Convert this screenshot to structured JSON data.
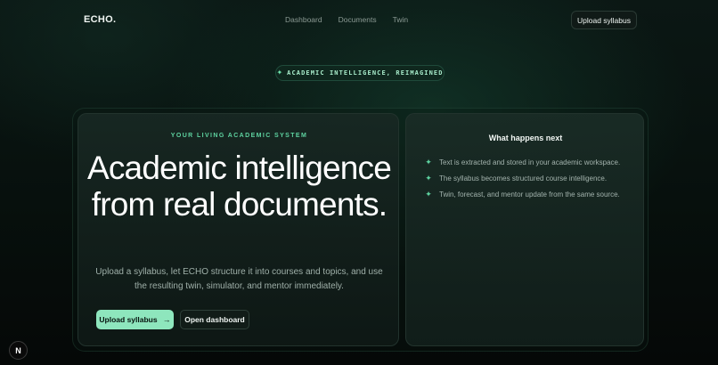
{
  "nav": {
    "logo": "ECHO.",
    "links": [
      {
        "label": "Dashboard"
      },
      {
        "label": "Documents"
      },
      {
        "label": "Twin"
      }
    ],
    "cta_label": "Upload syllabus"
  },
  "badge": {
    "icon": "sparkle-icon",
    "text": "ACADEMIC INTELLIGENCE, REIMAGINED"
  },
  "hero": {
    "eyebrow": "YOUR LIVING ACADEMIC SYSTEM",
    "headline": "Academic intelligence from real documents.",
    "subcopy": "Upload a syllabus, let ECHO structure it into courses and topics, and use the resulting twin, simulator, and mentor immediately.",
    "primary_label": "Upload syllabus",
    "primary_icon": "arrow-right-icon",
    "secondary_label": "Open dashboard"
  },
  "side": {
    "title": "What happens next",
    "steps": [
      {
        "icon": "sparkle-icon",
        "text": "Text is extracted and stored in your academic workspace."
      },
      {
        "icon": "sparkle-icon",
        "text": "The syllabus becomes structured course intelligence."
      },
      {
        "icon": "sparkle-icon",
        "text": "Twin, forecast, and mentor update from the same source."
      }
    ]
  },
  "floating_badge": {
    "letter": "N"
  },
  "colors": {
    "accent": "#8ee6bd",
    "accent_text": "#5ed3a0",
    "background": "#050807",
    "card": "#16241f"
  }
}
